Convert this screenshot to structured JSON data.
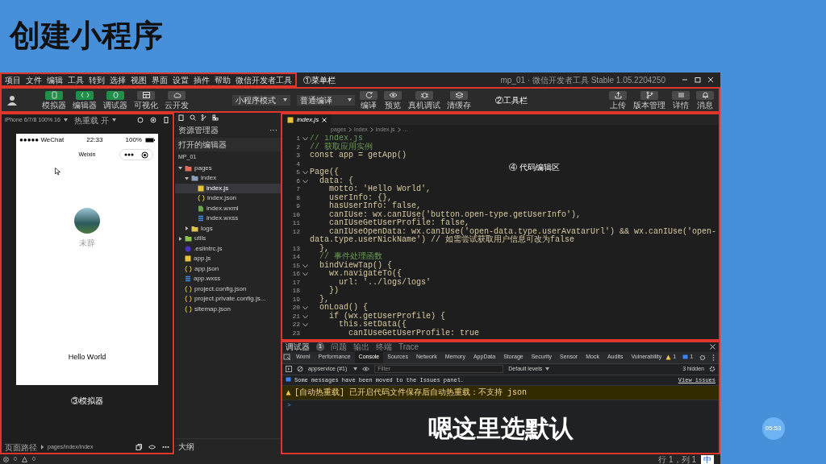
{
  "slide_title": "创建小程序",
  "window": {
    "title": "mp_01 · 微信开发者工具 Stable 1.05.2204250"
  },
  "menu": [
    "项目",
    "文件",
    "编辑",
    "工具",
    "转到",
    "选择",
    "视图",
    "界面",
    "设置",
    "插件",
    "帮助",
    "微信开发者工具"
  ],
  "annotations": {
    "menu": "①菜单栏",
    "toolbar": "②工具栏",
    "simulator": "③模拟器",
    "editor": "④ 代码编辑区"
  },
  "toolbar": {
    "views": [
      {
        "label": "模拟器",
        "kind": "phone",
        "on": true
      },
      {
        "label": "编辑器",
        "kind": "code",
        "on": true
      },
      {
        "label": "调试器",
        "kind": "debug",
        "on": true
      },
      {
        "label": "可视化",
        "kind": "layout",
        "on": false
      },
      {
        "label": "云开发",
        "kind": "cloud",
        "on": false
      }
    ],
    "dropdowns": [
      "小程序模式",
      "普通编译"
    ],
    "actions": [
      {
        "label": "编译",
        "kind": "refresh"
      },
      {
        "label": "预览",
        "kind": "eye"
      },
      {
        "label": "真机调试",
        "kind": "bug"
      },
      {
        "label": "清缓存",
        "kind": "stack"
      }
    ],
    "right_actions": [
      {
        "label": "上传",
        "kind": "upload"
      },
      {
        "label": "版本管理",
        "kind": "branch"
      },
      {
        "label": "详情",
        "kind": "lines"
      },
      {
        "label": "消息",
        "kind": "bell"
      }
    ]
  },
  "simulator": {
    "device": "iPhone 6/7/8 100% 16",
    "hot_reload": "热重载 开",
    "phone": {
      "carrier": "●●●●● WeChat",
      "time": "22:33",
      "battery": "100%",
      "nav_title": "Weixin",
      "nickname": "未辞",
      "motto": "Hello World"
    },
    "page_path_label": "页面路径",
    "page_path": "pages/index/index"
  },
  "explorer": {
    "title": "资源管理器",
    "more": "···",
    "open_editors": "打开的编辑器",
    "project": "MP_01",
    "outline": "大纲",
    "tree": [
      {
        "name": "pages",
        "kind": "folder-red",
        "expanded": true,
        "selected": false,
        "children": [
          {
            "name": "index",
            "kind": "folder",
            "expanded": true,
            "selected": false,
            "children": [
              {
                "name": "index.js",
                "kind": "js",
                "selected": true
              },
              {
                "name": "index.json",
                "kind": "json",
                "selected": false
              },
              {
                "name": "index.wxml",
                "kind": "wxml",
                "selected": false
              },
              {
                "name": "index.wxss",
                "kind": "wxss",
                "selected": false
              }
            ]
          },
          {
            "name": "logs",
            "kind": "folder-yellow",
            "expanded": false,
            "selected": false
          }
        ]
      },
      {
        "name": "utils",
        "kind": "folder-green",
        "expanded": false,
        "selected": false
      },
      {
        "name": ".eslintrc.js",
        "kind": "eslint",
        "selected": false
      },
      {
        "name": "app.js",
        "kind": "js",
        "selected": false
      },
      {
        "name": "app.json",
        "kind": "json",
        "selected": false
      },
      {
        "name": "app.wxss",
        "kind": "wxss",
        "selected": false
      },
      {
        "name": "project.config.json",
        "kind": "json",
        "selected": false
      },
      {
        "name": "project.private.config.js...",
        "kind": "json",
        "selected": false
      },
      {
        "name": "sitemap.json",
        "kind": "json",
        "selected": false
      }
    ]
  },
  "editor": {
    "tab": "index.js",
    "breadcrumb": [
      "pages",
      "index",
      "index.js",
      "..."
    ],
    "lines": [
      {
        "n": "1",
        "fold": true,
        "kind": "comment",
        "text": "// index.js"
      },
      {
        "n": "2",
        "fold": false,
        "kind": "comment",
        "text": "// 获取应用实例"
      },
      {
        "n": "3",
        "fold": false,
        "kind": "code",
        "text": "const app = getApp()"
      },
      {
        "n": "4",
        "fold": false
      },
      {
        "n": "5",
        "fold": true,
        "kind": "code",
        "text": "Page({"
      },
      {
        "n": "6",
        "fold": true,
        "kind": "code",
        "text": "  data: {"
      },
      {
        "n": "7",
        "fold": false,
        "kind": "code",
        "text": "    motto: 'Hello World',"
      },
      {
        "n": "8",
        "fold": false,
        "kind": "code",
        "text": "    userInfo: {},"
      },
      {
        "n": "9",
        "fold": false,
        "kind": "code",
        "text": "    hasUserInfo: false,"
      },
      {
        "n": "10",
        "fold": false,
        "kind": "code",
        "text": "    canIUse: wx.canIUse('button.open-type.getUserInfo'),"
      },
      {
        "n": "11",
        "fold": false,
        "kind": "code",
        "text": "    canIUseGetUserProfile: false,"
      },
      {
        "n": "12",
        "fold": false,
        "kind": "code",
        "text": "    canIUseOpenData: wx.canIUse('open-data.type.userAvatarUrl') && wx.canIUse('open-data.type.userNickName') // 如需尝试获取用户信息可改为false"
      },
      {
        "n": "13",
        "fold": false,
        "kind": "code",
        "text": "  },"
      },
      {
        "n": "14",
        "fold": false,
        "kind": "comment",
        "text": "  // 事件处理函数"
      },
      {
        "n": "15",
        "fold": true,
        "kind": "code",
        "text": "  bindViewTap() {"
      },
      {
        "n": "16",
        "fold": true,
        "kind": "code",
        "text": "    wx.navigateTo({"
      },
      {
        "n": "17",
        "fold": false,
        "kind": "code",
        "text": "      url: '../logs/logs'"
      },
      {
        "n": "18",
        "fold": false,
        "kind": "code",
        "text": "    })"
      },
      {
        "n": "19",
        "fold": false,
        "kind": "code",
        "text": "  },"
      },
      {
        "n": "20",
        "fold": true,
        "kind": "code",
        "text": "  onLoad() {"
      },
      {
        "n": "21",
        "fold": true,
        "kind": "code",
        "text": "    if (wx.getUserProfile) {"
      },
      {
        "n": "22",
        "fold": true,
        "kind": "code",
        "text": "      this.setData({"
      },
      {
        "n": "23",
        "fold": false,
        "kind": "code",
        "text": "        canIUseGetUserProfile: true"
      }
    ]
  },
  "devtools": {
    "tabs": [
      {
        "label": "调试器",
        "badge": "1",
        "selected": true
      },
      {
        "label": "问题",
        "selected": false
      },
      {
        "label": "输出",
        "selected": false
      },
      {
        "label": "终端",
        "selected": false
      },
      {
        "label": "Trace",
        "selected": false
      }
    ],
    "panels": [
      {
        "label": "Wxml",
        "selected": false
      },
      {
        "label": "Performance",
        "selected": false
      },
      {
        "label": "Console",
        "selected": true
      },
      {
        "label": "Sources",
        "selected": false
      },
      {
        "label": "Network",
        "selected": false
      },
      {
        "label": "Memory",
        "selected": false
      },
      {
        "label": "AppData",
        "selected": false
      },
      {
        "label": "Storage",
        "selected": false
      },
      {
        "label": "Security",
        "selected": false
      },
      {
        "label": "Sensor",
        "selected": false
      },
      {
        "label": "Mock",
        "selected": false
      },
      {
        "label": "Audits",
        "selected": false
      },
      {
        "label": "Vulnerability",
        "selected": false
      }
    ],
    "warning_count": "1",
    "info_count": "1",
    "context": "appservice (#1)",
    "filter": {
      "placeholder": "Filter"
    },
    "levels": "Default levels",
    "hidden": "3 hidden",
    "messages": [
      {
        "kind": "info",
        "text": "Some messages have been moved to the Issues panel.",
        "link": "View issues"
      },
      {
        "kind": "warning",
        "text": "[自动热重载] 已开启代码文件保存后自动热重载：不支持 json"
      }
    ],
    "prompt": ">"
  },
  "status_bar": {
    "errors": "0",
    "warnings": "0",
    "position": "行 1，列 1",
    "ime": "中"
  },
  "subtitle": "嗯这里选默认",
  "timer": "05:53"
}
